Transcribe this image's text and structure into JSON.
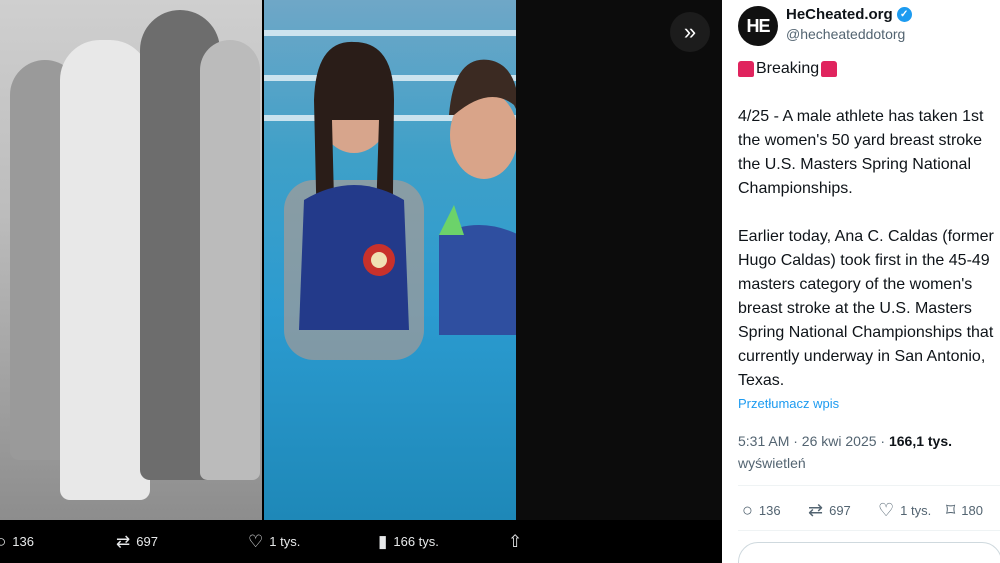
{
  "bottom_stats": {
    "replies": "136",
    "reposts": "697",
    "likes": "1 tys.",
    "views": "166 tys."
  },
  "tweet": {
    "display_name": "HeCheated.org",
    "handle": "@hecheateddotorg",
    "avatar_text": "HE",
    "breaking_label": "Breaking",
    "body": "4/25 - A male athlete has taken 1st\nthe women's 50 yard breast stroke\nthe U.S. Masters Spring National\nChampionships.\n\nEarlier today, Ana C. Caldas (former\nHugo Caldas) took first in the 45-49\nmasters category of the women's\nbreast stroke at the U.S. Masters\nSpring National Championships that\ncurrently underway in San Antonio,\nTexas.",
    "translate_label": "Przetłumacz wpis",
    "time": "5:31 AM · 26 kwi 2025 · ",
    "views_count": "166,1 tys.",
    "views_label": "wyświetleń",
    "replies": "136",
    "reposts": "697",
    "likes": "1 tys.",
    "bookmarks": "180"
  },
  "colors": {
    "accent": "#1d9bf0",
    "siren": "#e0245e"
  }
}
